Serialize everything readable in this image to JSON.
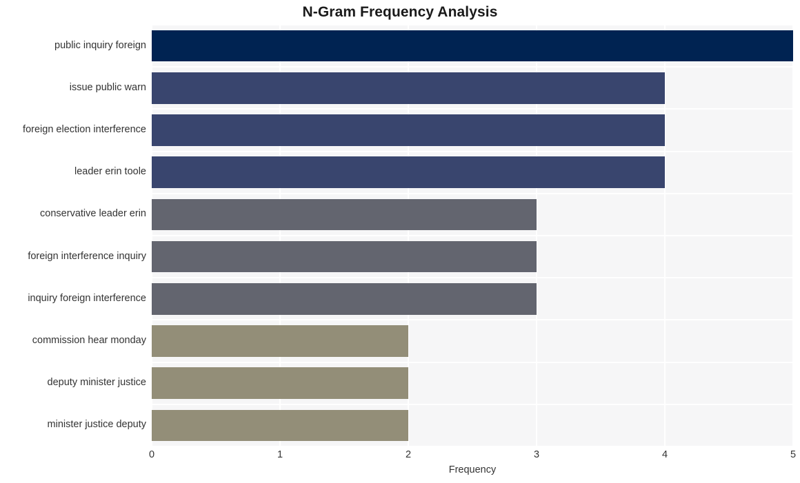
{
  "chart_data": {
    "type": "bar",
    "orientation": "horizontal",
    "title": "N-Gram Frequency Analysis",
    "xlabel": "Frequency",
    "ylabel": "",
    "categories": [
      "public inquiry foreign",
      "issue public warn",
      "foreign election interference",
      "leader erin toole",
      "conservative leader erin",
      "foreign interference inquiry",
      "inquiry foreign interference",
      "commission hear monday",
      "deputy minister justice",
      "minister justice deputy"
    ],
    "values": [
      5,
      4,
      4,
      4,
      3,
      3,
      3,
      2,
      2,
      2
    ],
    "bar_colors": [
      "#002352",
      "#39456e",
      "#39456e",
      "#39456e",
      "#63656f",
      "#63656f",
      "#63656f",
      "#938e78",
      "#938e78",
      "#938e78"
    ],
    "xlim": [
      0,
      5
    ],
    "xticks": [
      0,
      1,
      2,
      3,
      4,
      5
    ],
    "xtick_labels": [
      "0",
      "1",
      "2",
      "3",
      "4",
      "5"
    ],
    "grid": true,
    "grid_color": "#ffffff",
    "plot_background": "#f6f6f7",
    "figure_background": "#ffffff",
    "legend": null
  }
}
